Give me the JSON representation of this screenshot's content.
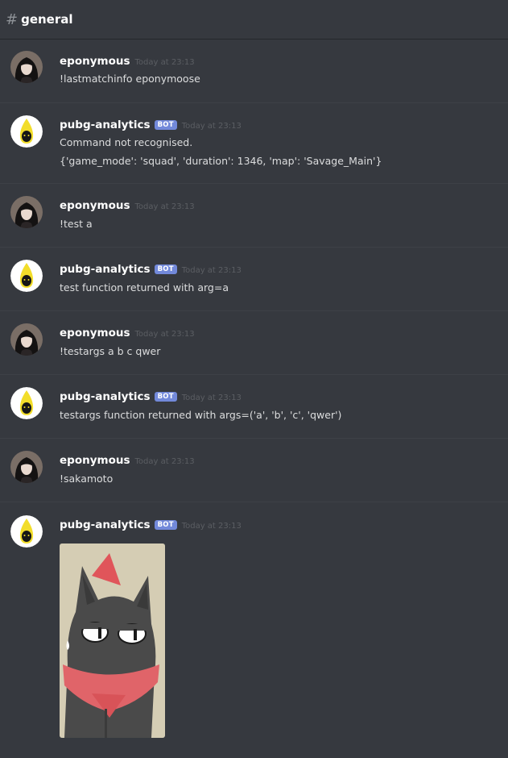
{
  "channel": {
    "hash": "#",
    "name": "general"
  },
  "messages": [
    {
      "author": "eponymous",
      "timestamp": "Today at 23:13",
      "lines": [
        "!lastmatchinfo eponymoose"
      ]
    },
    {
      "author": "pubg-analytics",
      "bot_tag": "BOT",
      "timestamp": "Today at 23:13",
      "lines": [
        "Command not recognised.",
        "{'game_mode': 'squad', 'duration': 1346, 'map': 'Savage_Main'}"
      ]
    },
    {
      "author": "eponymous",
      "timestamp": "Today at 23:13",
      "lines": [
        "!test a"
      ]
    },
    {
      "author": "pubg-analytics",
      "bot_tag": "BOT",
      "timestamp": "Today at 23:13",
      "lines": [
        "test function returned with arg=a"
      ]
    },
    {
      "author": "eponymous",
      "timestamp": "Today at 23:13",
      "lines": [
        "!testargs a b c qwer"
      ]
    },
    {
      "author": "pubg-analytics",
      "bot_tag": "BOT",
      "timestamp": "Today at 23:13",
      "lines": [
        "testargs function returned with args=('a', 'b', 'c', 'qwer')"
      ]
    },
    {
      "author": "eponymous",
      "timestamp": "Today at 23:13",
      "lines": [
        "!sakamoto"
      ]
    },
    {
      "author": "pubg-analytics",
      "bot_tag": "BOT",
      "timestamp": "Today at 23:13",
      "lines": []
    }
  ],
  "colors": {
    "background": "#36393f",
    "bot_tag": "#7289da",
    "text": "#dcddde",
    "timestamp": "#5b5e63"
  },
  "icons": [
    "user-avatar-icon",
    "bot-avatar-icon",
    "cat-image"
  ]
}
